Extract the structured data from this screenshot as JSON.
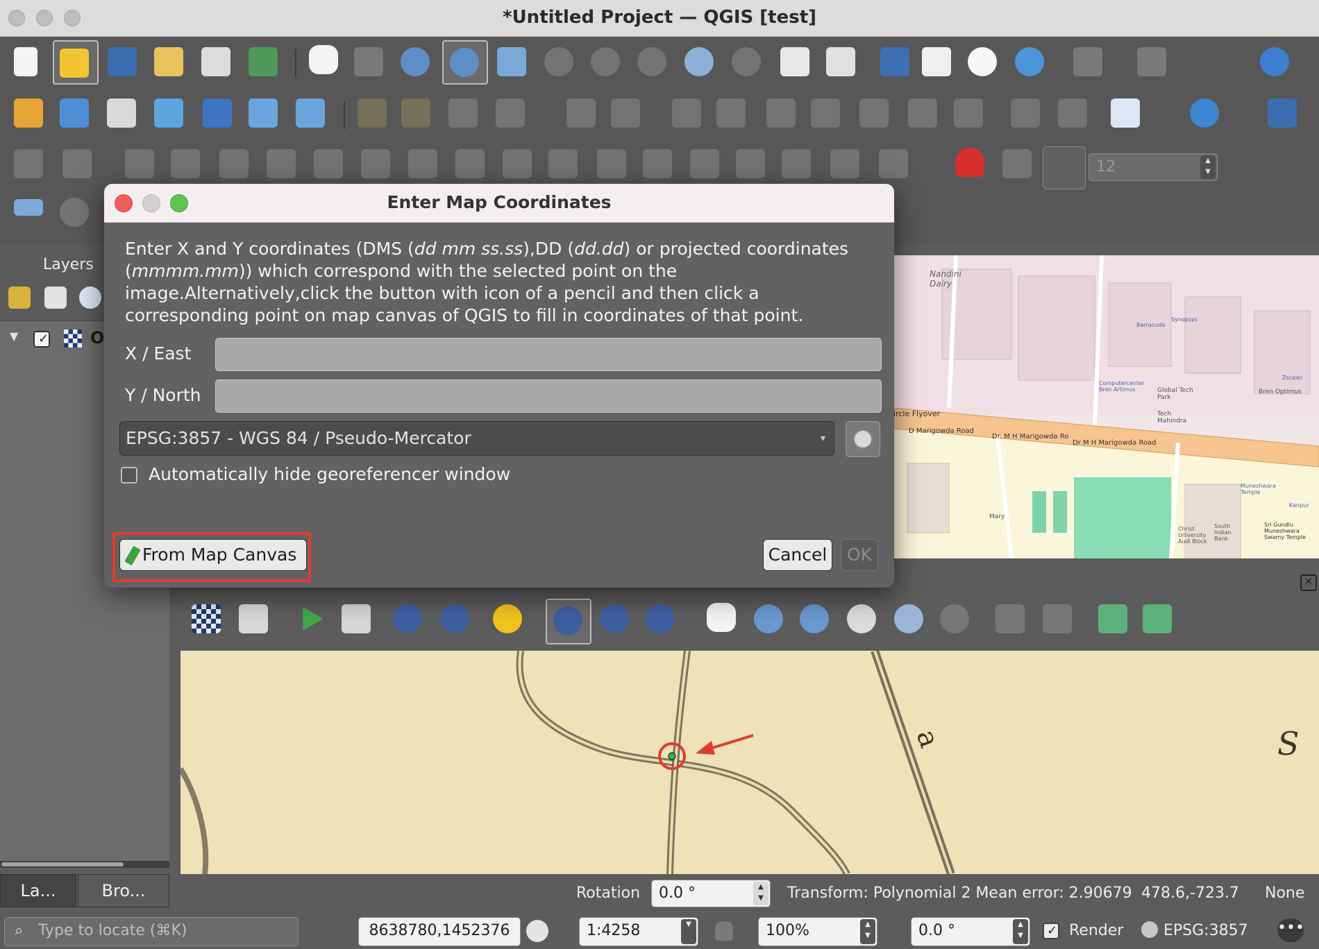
{
  "window": {
    "title": "*Untitled Project — QGIS [test]"
  },
  "layers_panel": {
    "title": "Layers",
    "layer_name": "O",
    "tabs": [
      "La...",
      "Bro..."
    ]
  },
  "snapping": {
    "tolerance": "12"
  },
  "map_labels": {
    "nandini_dairy": "Nandini Dairy",
    "circle_flyover": "ircle Flyover",
    "road1": "D Marigowda Road",
    "road2": "Dr. M H Marigowda Ro",
    "road3": "Dr M H Marigowda Road",
    "synopsys": "Synopsys",
    "barracuda": "Barracuda",
    "computercenter": "Computercenter Bren Artimus",
    "global_tech_park": "Global Tech Park",
    "tech_mahindra": "Tech Mahindra",
    "zscaler": "Zscaler",
    "bren_optimus": "Bren Optimus",
    "mary": "Mary",
    "christ_university": "Christ University Audi Block",
    "south_indian_bank": "South Indian Bank",
    "muneshwara": "Muneshwara Temple",
    "sri_gundlu": "Sri Gundlu Muneshwara Swamy Temple",
    "kanpur": "Kanpur"
  },
  "dialog": {
    "title": "Enter Map Coordinates",
    "desc_1": "Enter X and Y coordinates (DMS (",
    "desc_dms": "dd mm ss.ss",
    "desc_2": "),DD (",
    "desc_dd": "dd.dd",
    "desc_3": ") or projected coordinates (",
    "desc_proj": "mmmm.mm",
    "desc_4": ")) which correspond with the selected point on the image.Alternatively,click the button with icon of a pencil and then click a corresponding point on map canvas of QGIS to fill in coordinates of that point.",
    "x_label": "X / East",
    "x_value": "",
    "y_label": "Y / North",
    "y_value": "",
    "crs": "EPSG:3857 - WGS 84 / Pseudo-Mercator",
    "auto_hide_label": "Automatically hide georeferencer window",
    "auto_hide_checked": false,
    "from_canvas_label": "From Map Canvas",
    "cancel_label": "Cancel",
    "ok_label": "OK"
  },
  "georef_status": {
    "rotation_label": "Rotation",
    "rotation_value": "0.0 °",
    "transform": "Transform: Polynomial 2 Mean error: 2.90679",
    "coords": "478.6,-723.7",
    "crs": "None"
  },
  "status_bar": {
    "locate_placeholder": "Type to locate (⌘K)",
    "coordinate": "8638780,1452376",
    "scale": "1:4258",
    "magnifier": "100%",
    "rotation": "0.0 °",
    "render_label": "Render",
    "crs": "EPSG:3857"
  },
  "colors": {
    "accent_red": "#e23b2e",
    "map_road": "#f6c48e",
    "map_green": "#88dcb5"
  }
}
